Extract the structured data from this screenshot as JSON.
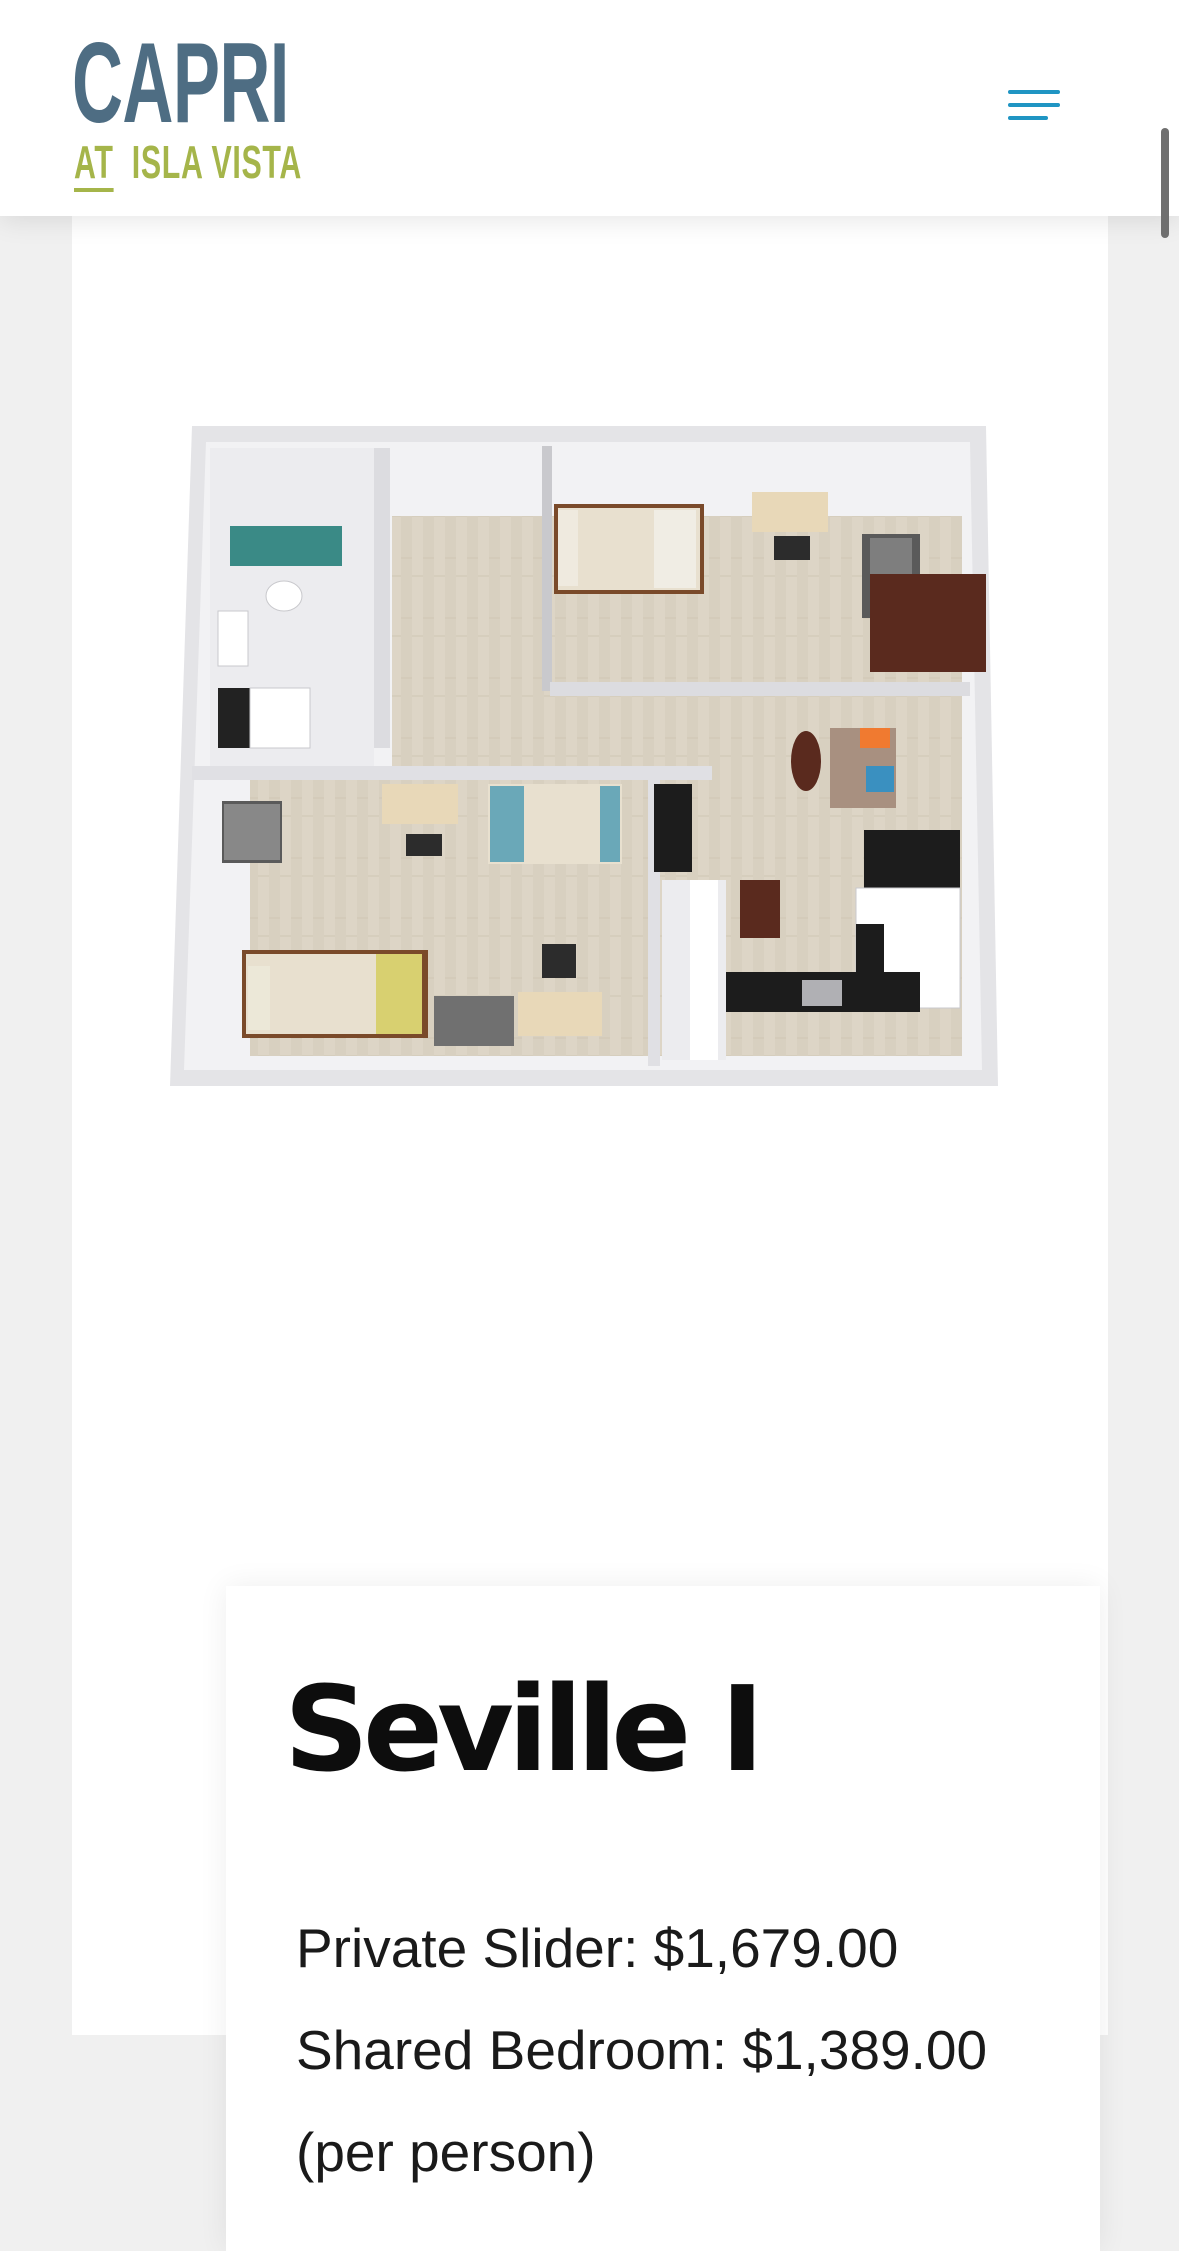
{
  "header": {
    "logo": {
      "line1": "CAPRI",
      "line2_part1": "AT",
      "line2_part2": "ISLA VISTA"
    },
    "menu_icon": "hamburger-menu-icon",
    "colors": {
      "logo_blue": "#4e6d83",
      "logo_green": "#a5b54a",
      "menu_blue": "#1f95c3"
    }
  },
  "floorplan": {
    "icon": "floor-plan-image"
  },
  "unit": {
    "title": "Seville I",
    "private_slider": "Private Slider: $1,679.00",
    "shared_bedroom": "Shared Bedroom: $1,389.00",
    "per_person": "(per person)"
  }
}
